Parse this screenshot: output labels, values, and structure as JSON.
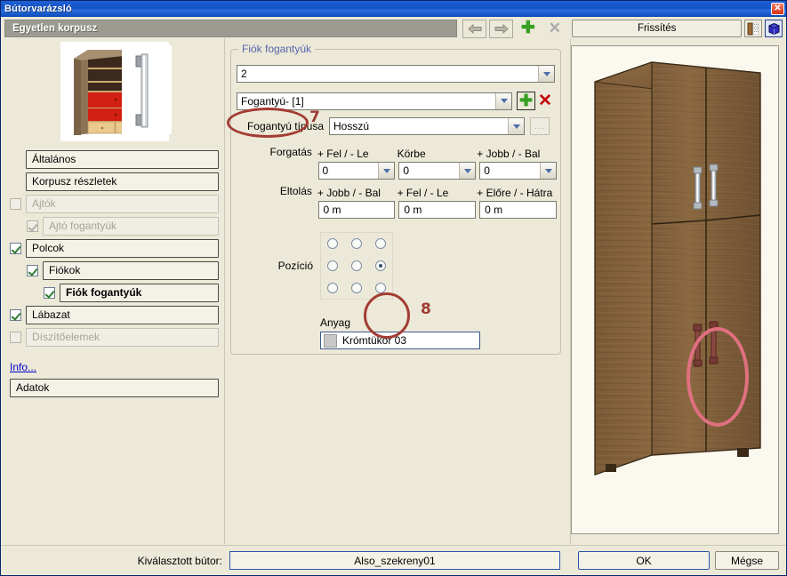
{
  "window": {
    "title": "Bútorvarázsló",
    "close_label": "✕",
    "subtitle": "Egyetlen korpusz"
  },
  "nav": {
    "back_icon": "arrow-left-icon",
    "forward_icon": "arrow-right-icon",
    "add_icon": "plus-icon",
    "delete_icon": "close-x-icon",
    "add_label": "✚",
    "delete_label": "✕"
  },
  "preview_toolbar": {
    "refresh_label": "Frissítés",
    "texture_icon": "door-texture-icon",
    "cube_icon": "cube-3d-icon"
  },
  "sidebar": {
    "items": [
      {
        "label": "Általános",
        "indent": 0,
        "checkbox": false,
        "checked": false,
        "disabled": false,
        "bold": false
      },
      {
        "label": "Korpusz részletek",
        "indent": 0,
        "checkbox": false,
        "checked": false,
        "disabled": false,
        "bold": false
      },
      {
        "label": "Ajtók",
        "indent": 0,
        "checkbox": true,
        "checked": false,
        "disabled": true,
        "bold": false
      },
      {
        "label": "Ajtó fogantyúk",
        "indent": 1,
        "checkbox": true,
        "checked": true,
        "disabled": true,
        "bold": false
      },
      {
        "label": "Polcok",
        "indent": 0,
        "checkbox": true,
        "checked": true,
        "disabled": false,
        "bold": false
      },
      {
        "label": "Fiókok",
        "indent": 1,
        "checkbox": true,
        "checked": true,
        "disabled": false,
        "bold": false
      },
      {
        "label": "Fiók fogantyúk",
        "indent": 2,
        "checkbox": true,
        "checked": true,
        "disabled": false,
        "bold": true
      },
      {
        "label": "Lábazat",
        "indent": 0,
        "checkbox": true,
        "checked": true,
        "disabled": false,
        "bold": false
      },
      {
        "label": "Díszítőelemek",
        "indent": 0,
        "checkbox": true,
        "checked": false,
        "disabled": true,
        "bold": false
      }
    ],
    "info_link": "Info...",
    "data_button": "Adatok"
  },
  "panel": {
    "group_title": "Fiók fogantyúk",
    "count_combo_value": "2",
    "handle_combo_value": "Fogantyú- [1]",
    "add_label": "✚",
    "remove_label": "✕",
    "handle_type_label": "Fogantyú típusa",
    "handle_type_value": "Hosszú",
    "more_button_label": "...",
    "rotation": {
      "label": "Forgatás",
      "fields": [
        {
          "label": "+ Fel / - Le",
          "value": "0"
        },
        {
          "label": "Körbe",
          "value": "0"
        },
        {
          "label": "+ Jobb / - Bal",
          "value": "0"
        }
      ]
    },
    "offset": {
      "label": "Eltolás",
      "fields": [
        {
          "label": "+ Jobb / - Bal",
          "value": "0 m"
        },
        {
          "label": "+ Fel / - Le",
          "value": "0 m"
        },
        {
          "label": "+ Előre / - Hátra",
          "value": "0 m"
        }
      ]
    },
    "position": {
      "label": "Pozíció",
      "selected_index": 5
    },
    "material": {
      "label": "Anyag",
      "value": "Krómtükör 03",
      "swatch_color": "#c8c8c8"
    }
  },
  "annotations": [
    {
      "number": "7"
    },
    {
      "number": "8"
    }
  ],
  "footer": {
    "selected_label": "Kiválasztott bútor:",
    "selected_value": "Also_szekreny01",
    "ok_label": "OK",
    "cancel_label": "Mégse"
  },
  "colors": {
    "titlebar": "#1453c8",
    "dialog_bg": "#ece9d8",
    "annotation_red": "#a33c33",
    "annotation_pink": "#e0707f",
    "group_title": "#5566aa",
    "link": "#0000cc"
  }
}
